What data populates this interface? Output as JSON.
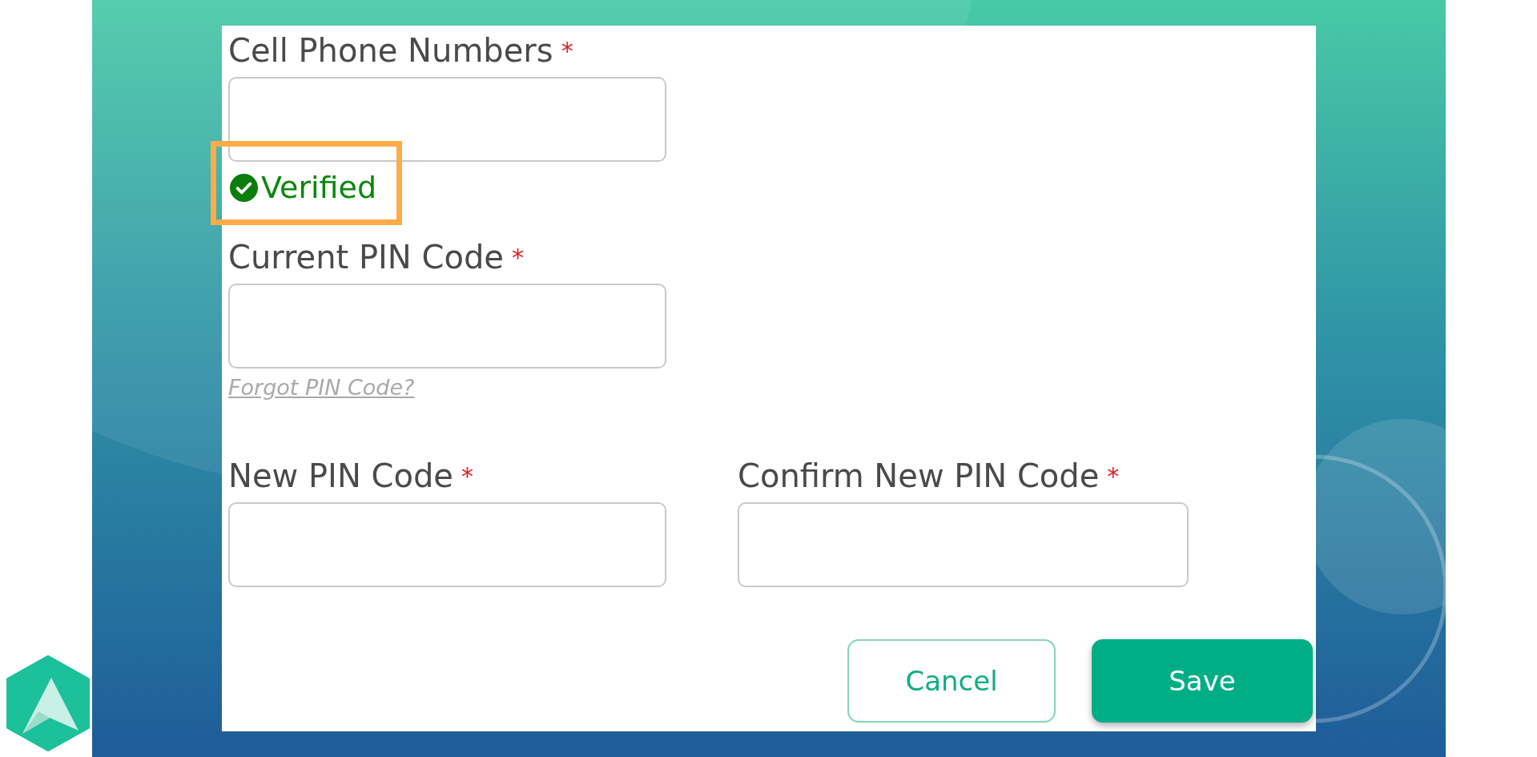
{
  "rows": [
    [
      {
        "label": "Cell Phone Numbers",
        "required_mark": "*",
        "status": "Verified",
        "verified": true,
        "highlighted": true
      }
    ],
    [
      {
        "label": "Current PIN Code",
        "required_mark": "*",
        "link": "Forgot PIN Code?"
      }
    ],
    [
      {
        "label": "New PIN Code",
        "required_mark": "*"
      },
      {
        "label": "Confirm New PIN Code",
        "required_mark": "*"
      }
    ]
  ],
  "buttons": [
    {
      "label": "Cancel",
      "kind": "secondary"
    },
    {
      "label": "Save",
      "kind": "primary"
    }
  ]
}
